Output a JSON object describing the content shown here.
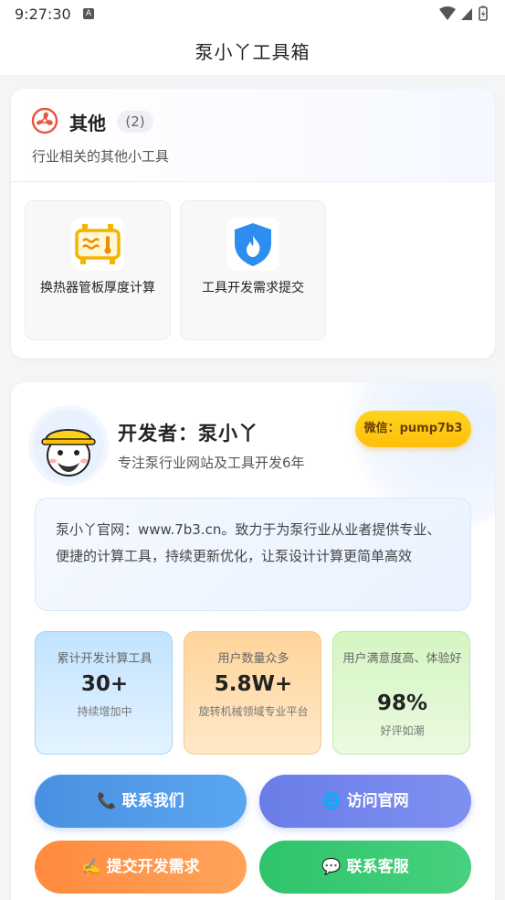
{
  "status_bar": {
    "time": "9:27:30"
  },
  "app_bar": {
    "title": "泵小丫工具箱"
  },
  "other_section": {
    "title": "其他",
    "count": "(2)",
    "description": "行业相关的其他小工具",
    "tools": [
      {
        "label": "换热器管板厚度计算",
        "icon": "heat-exchanger-icon"
      },
      {
        "label": "工具开发需求提交",
        "icon": "fire-shield-icon"
      }
    ]
  },
  "developer": {
    "name": "开发者：泵小丫",
    "subtitle": "专注泵行业网站及工具开发6年",
    "wechat": "微信：pump7b3",
    "intro": "泵小丫官网：www.7b3.cn。致力于为泵行业从业者提供专业、便捷的计算工具，持续更新优化，让泵设计计算更简单高效",
    "stats": [
      {
        "label": "累计开发计算工具",
        "value": "30+",
        "sub": "持续增加中"
      },
      {
        "label": "用户数量众多",
        "value": "5.8W+",
        "sub": "旋转机械领域专业平台"
      },
      {
        "label": "用户满意度高、体验好",
        "value": "98%",
        "sub": "好评如潮"
      }
    ],
    "buttons": {
      "contact": "联系我们",
      "website": "访问官网",
      "submit": "提交开发需求",
      "service": "联系客服"
    }
  },
  "colors": {
    "accent_blue": "#4a90e2",
    "accent_purple": "#6a7de8",
    "accent_orange": "#ff8a3d",
    "accent_green": "#2ec46a",
    "wechat_yellow": "#ffc20e"
  }
}
